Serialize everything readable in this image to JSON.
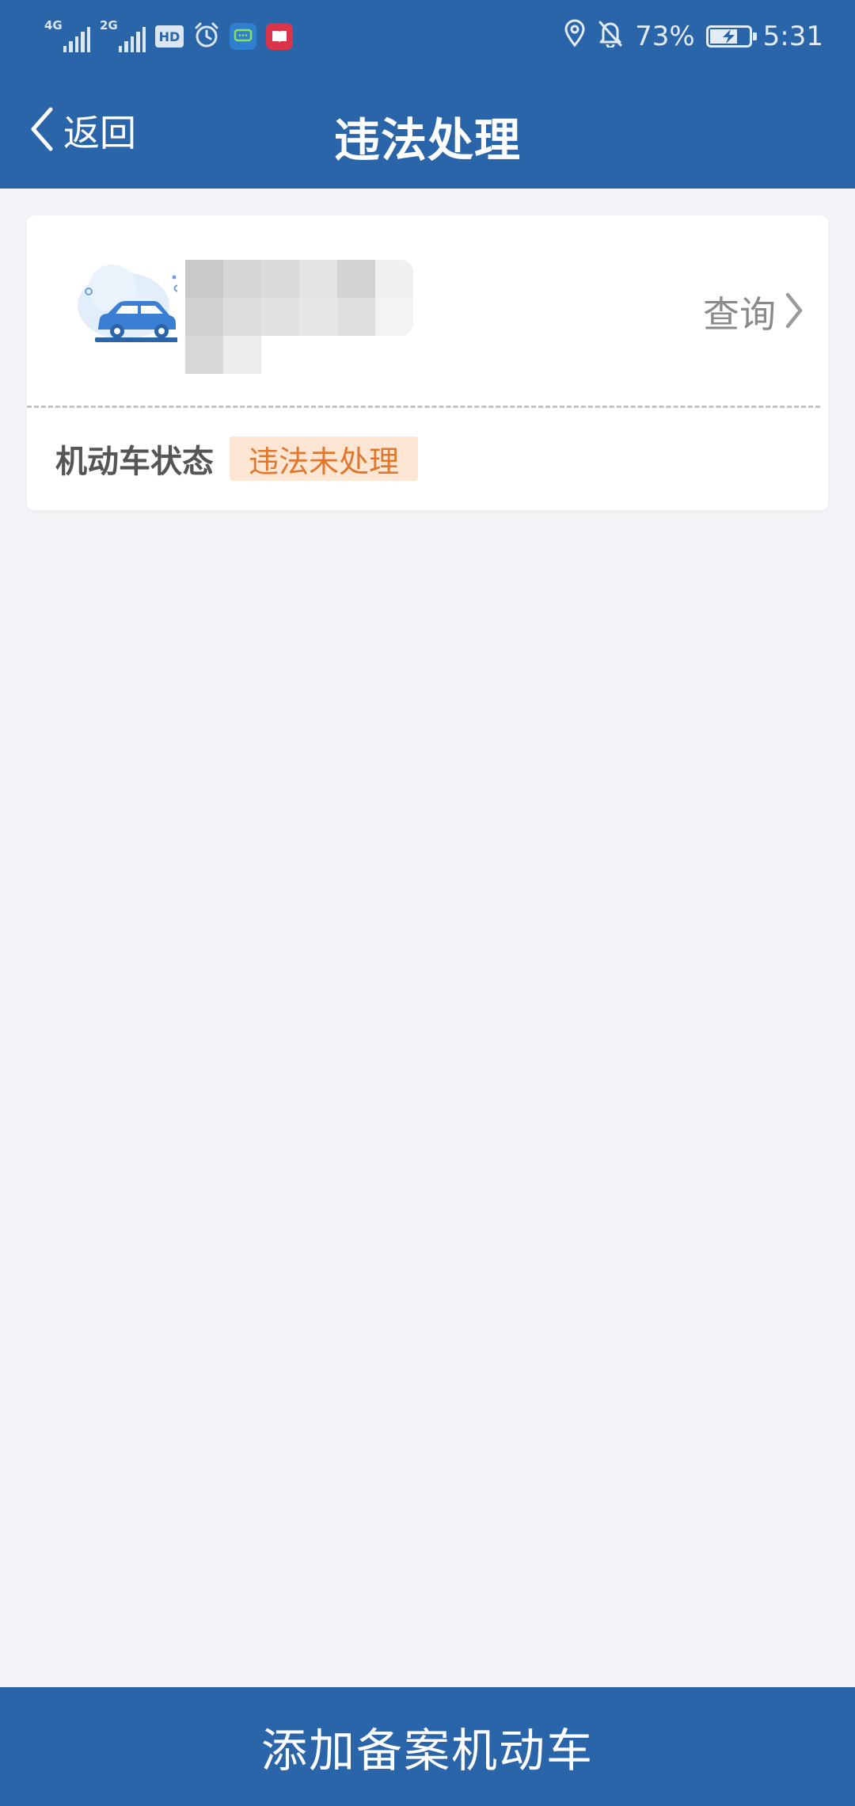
{
  "status_bar": {
    "signal_1_type": "4G",
    "signal_2_type": "2G",
    "hd_label": "HD",
    "battery_percent": "73%",
    "battery_level": 0.73,
    "time": "5:31",
    "icons": [
      "signal-4g-icon",
      "signal-2g-icon",
      "hd-icon",
      "alarm-icon",
      "message-app-icon",
      "book-app-icon",
      "location-icon",
      "bell-off-icon",
      "battery-charging-icon"
    ]
  },
  "header": {
    "back_label": "返回",
    "title": "违法处理"
  },
  "vehicle_card": {
    "icon": "car-icon",
    "plate_text": "",
    "query_label": "查询",
    "status_label": "机动车状态",
    "status_value": "违法未处理"
  },
  "footer": {
    "add_button_label": "添加备案机动车"
  },
  "colors": {
    "primary_blue": "#2b65a9",
    "page_background": "#f3f4f7",
    "badge_background": "#fde6d3",
    "badge_text": "#e0772c"
  }
}
